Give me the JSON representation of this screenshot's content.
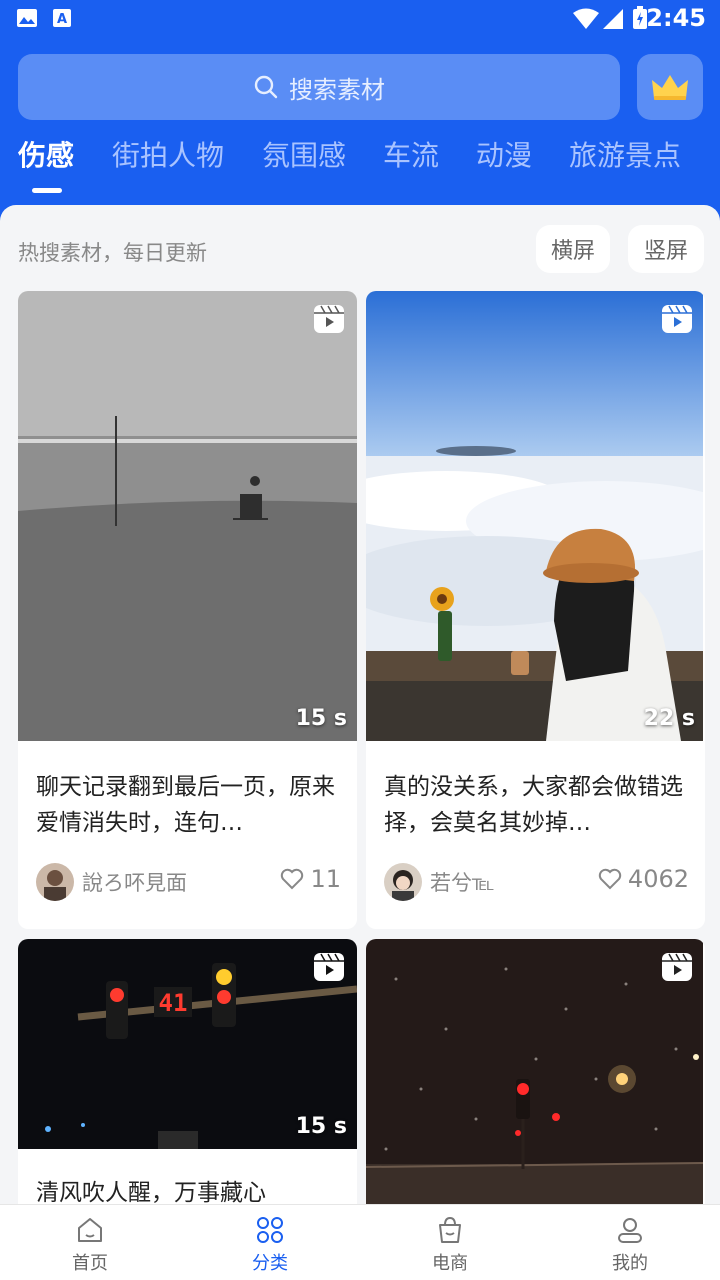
{
  "status_bar": {
    "time": "2:45"
  },
  "search": {
    "placeholder": "搜索素材"
  },
  "tabs": [
    "伤感",
    "街拍人物",
    "氛围感",
    "车流",
    "动漫",
    "旅游景点"
  ],
  "hint": "热搜素材，每日更新",
  "orientation": {
    "landscape": "横屏",
    "portrait": "竖屏"
  },
  "cards": [
    {
      "title": "聊天记录翻到最后一页，原来爱情消失时，连句…",
      "author": "說ろ吥見面",
      "likes": "11",
      "duration": "15 s"
    },
    {
      "title": "真的没关系，大家都会做错选择，会莫名其妙掉…",
      "author": "若兮℡",
      "likes": "4062",
      "duration": "22 s"
    },
    {
      "title": "清风吹人醒，万事藏心",
      "duration": "15 s"
    },
    {
      "title": ""
    }
  ],
  "bottom_nav": [
    {
      "label": "首页",
      "icon": "home-icon"
    },
    {
      "label": "分类",
      "icon": "grid-icon"
    },
    {
      "label": "电商",
      "icon": "shopping-bag-icon"
    },
    {
      "label": "我的",
      "icon": "user-icon"
    }
  ],
  "colors": {
    "primary": "#1a5ff0",
    "search_bg": "#5a8df5",
    "tab_inactive": "#a9c3ff"
  }
}
